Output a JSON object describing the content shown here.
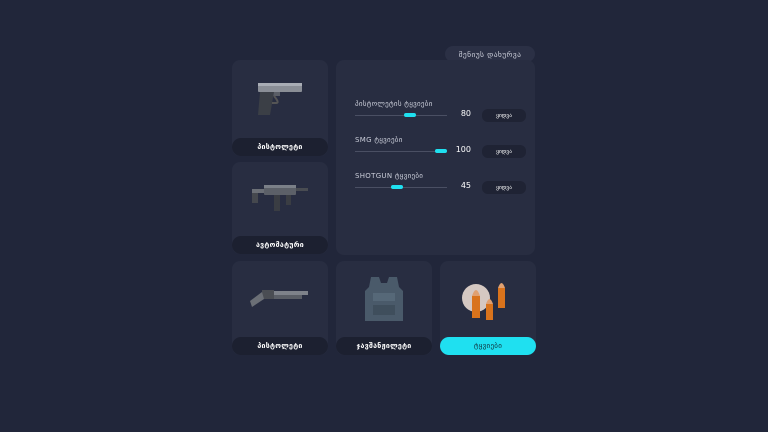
{
  "close_button": "მენიუს დახურვა",
  "cards": [
    {
      "label": "პისტოლეტი",
      "icon": "pistol-icon"
    },
    {
      "label": "ავტომატური",
      "icon": "smg-icon"
    },
    {
      "label": "პისტოლეტი",
      "icon": "shotgun-icon"
    },
    {
      "label": "ჯავშანჟილეტი",
      "icon": "armor-vest-icon"
    },
    {
      "label": "ტყვიები",
      "icon": "ammo-icon",
      "active": true
    }
  ],
  "ammo": [
    {
      "title": "პისტოლეტის ტყვიები",
      "value": "80",
      "fraction": 0.6,
      "buy": "ყიდვა"
    },
    {
      "title": "SMG ტყვიები",
      "value": "100",
      "fraction": 0.93,
      "buy": "ყიდვა"
    },
    {
      "title": "SHOTGUN ტყვიები",
      "value": "45",
      "fraction": 0.46,
      "buy": "ყიდვა"
    }
  ],
  "colors": {
    "accent": "#1fe0f0",
    "background": "#21263a",
    "card": "#282d41"
  }
}
